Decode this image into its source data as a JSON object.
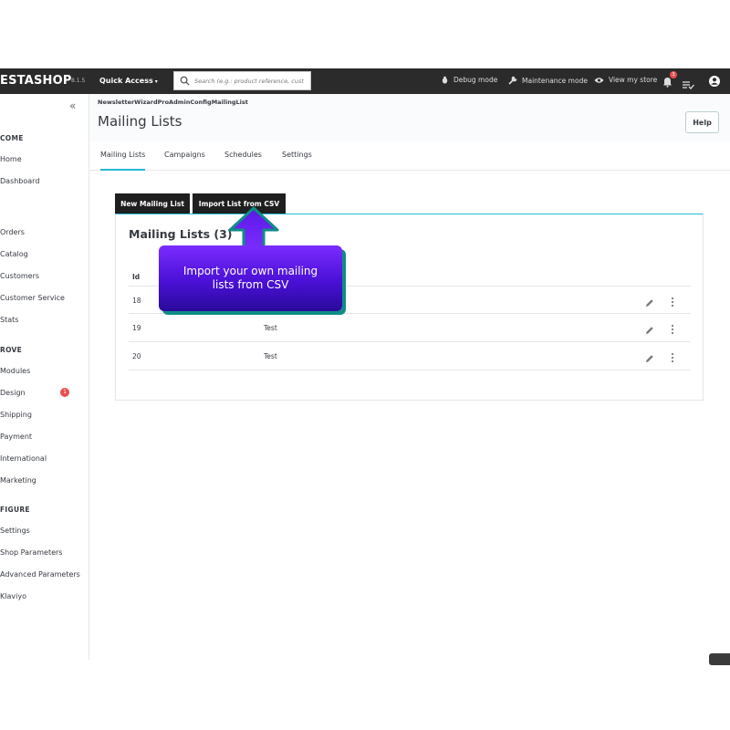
{
  "topbar": {
    "brand": "ESTASHOP",
    "version": "8.1.5",
    "quick_access": "Quick Access",
    "search_placeholder": "Search (e.g.: product reference, custon",
    "debug_mode": "Debug mode",
    "maintenance_mode": "Maintenance mode",
    "view_store": "View my store",
    "notification_count": "3"
  },
  "sidebar": {
    "collapse_label": "«",
    "sections": [
      {
        "label": "COME",
        "items": [
          "Home",
          "Dashboard"
        ]
      },
      {
        "label": "",
        "items": [
          "Orders",
          "Catalog",
          "Customers",
          "Customer Service",
          "Stats"
        ]
      },
      {
        "label": "ROVE",
        "items": [
          "Modules",
          "Design",
          "Shipping",
          "Payment",
          "International",
          "Marketing"
        ]
      },
      {
        "label": "FIGURE",
        "items": [
          "Settings",
          "Shop Parameters",
          "Advanced Parameters",
          "Klaviyo"
        ]
      }
    ],
    "design_badge": "1"
  },
  "header": {
    "breadcrumb": "NewsletterWizardProAdminConfigMailingList",
    "title": "Mailing Lists",
    "help": "Help"
  },
  "tabs": [
    "Mailing Lists",
    "Campaigns",
    "Schedules",
    "Settings"
  ],
  "content": {
    "new_list_button": "New Mailing List",
    "import_button": "Import List from CSV",
    "panel_title": "Mailing Lists (3)",
    "columns": [
      "Id"
    ],
    "rows": [
      {
        "id": "18",
        "name": ""
      },
      {
        "id": "19",
        "name": "Test"
      },
      {
        "id": "20",
        "name": "Test"
      }
    ]
  },
  "callout": {
    "text": "Import your own mailing lists from CSV"
  },
  "colors": {
    "topbar": "#2b2b2b",
    "accent": "#25b9d7",
    "callout_purple": "#5a18e6",
    "callout_shadow": "#0f8c86",
    "badge_red": "#e84e4e"
  }
}
